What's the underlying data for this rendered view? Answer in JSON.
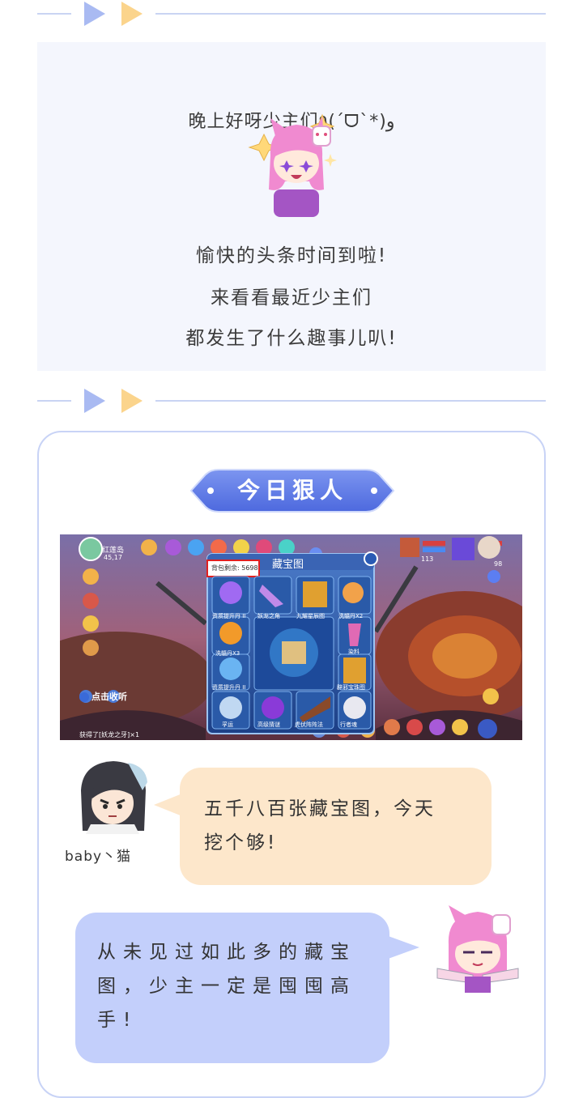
{
  "intro": {
    "greeting": "晚上好呀少主们٩(ˊᗜˋ*)و",
    "lines": [
      "愉快的头条时间到啦!",
      "来看看最近少主们",
      "都发生了什么趣事儿叭!"
    ]
  },
  "section": {
    "title": "今日狠人"
  },
  "game_screenshot": {
    "location": "红莲岛",
    "coords": "45,17",
    "panel_title": "藏宝图",
    "bag_remaining": "背包剩余: 5698",
    "items": [
      "资质提升丹 II",
      "妖龙之角",
      "九耀星辰图",
      "洗髓丹X2",
      "洗髓丹X3",
      "染料",
      "资质提升丹 II",
      "辟邪宝珠图",
      "孚运",
      "高级猜谜",
      "虎伏阵阵法",
      "行者魂"
    ],
    "listen_label": "点击收听",
    "chat_msg": "获得了[妖龙之牙]×1",
    "level": "113",
    "level2": "98"
  },
  "chat": {
    "user_name": "baby丶猫",
    "user_msg": "五千八百张藏宝图，今天\n挖个够!",
    "reply_msg": "从未见过如此多的藏宝\n图，少主一定是囤囤高\n手!"
  },
  "colors": {
    "accent_blue": "#5d7be6",
    "divider_blue": "#a9baf2",
    "divider_yellow": "#fbd48c",
    "bubble_orange": "#fde7cb",
    "bubble_blue": "#c3cffb"
  }
}
